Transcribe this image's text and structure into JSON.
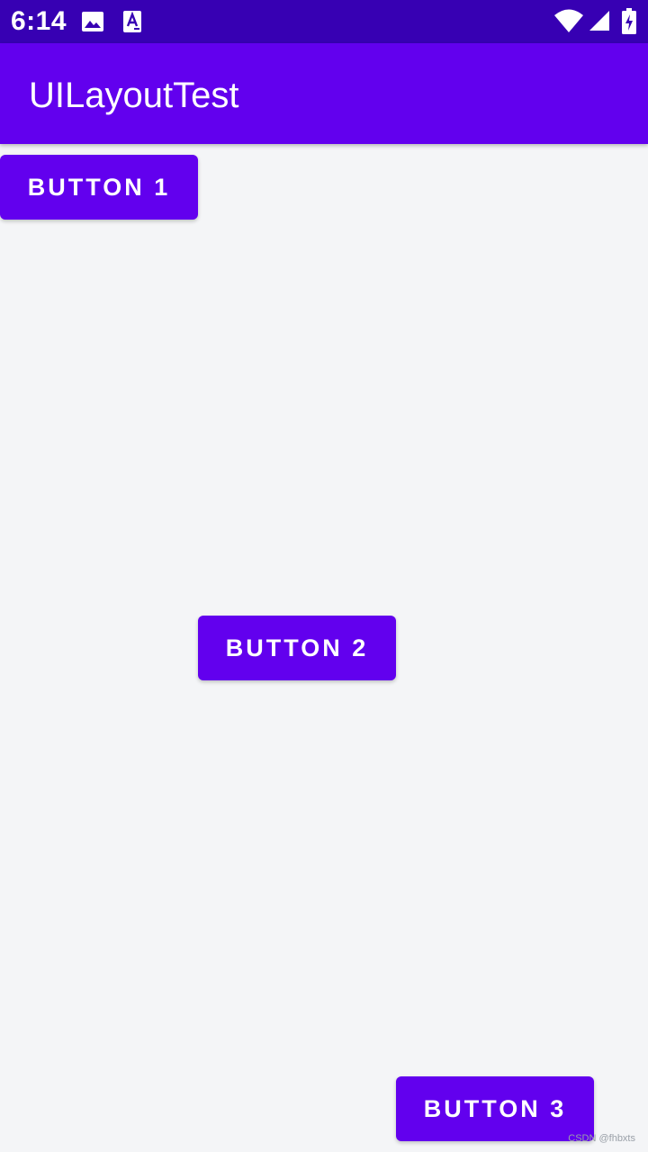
{
  "status_bar": {
    "time": "6:14",
    "icons": [
      "image-notification-icon",
      "a-notification-icon",
      "wifi-icon",
      "cell-signal-icon",
      "battery-charging-icon"
    ]
  },
  "app_bar": {
    "title": "UILayoutTest"
  },
  "buttons": [
    {
      "label": "BUTTON 1"
    },
    {
      "label": "BUTTON 2"
    },
    {
      "label": "BUTTON 3"
    }
  ],
  "watermark": "CSDN @fhbxts",
  "colors": {
    "status_bar": "#3700b3",
    "primary": "#6200ee",
    "background": "#f4f5f7",
    "on_primary": "#ffffff"
  }
}
